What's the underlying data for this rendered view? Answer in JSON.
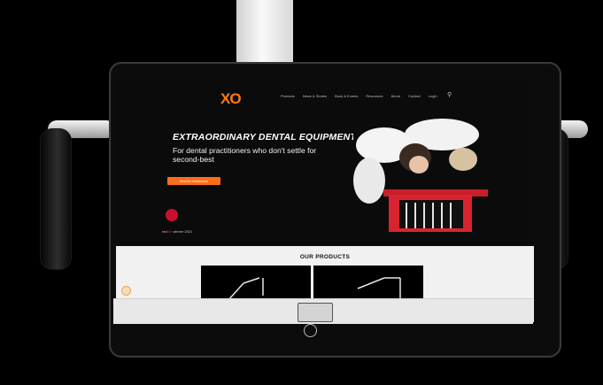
{
  "navigation": {
    "logo": "XO",
    "items": [
      "Products",
      "News & Stories",
      "Book & Events",
      "Resources",
      "About",
      "Contact",
      "Login"
    ]
  },
  "hero": {
    "headline": "EXTRAORDINARY DENTAL EQUIPMENT",
    "subtitle": "For dental practitioners who don't settle for second-best",
    "cta_label": "Read the reviews here",
    "award_prefix": "red",
    "award_highlight": "dot",
    "award_suffix": " winner 2021"
  },
  "products": {
    "title": "OUR PRODUCTS"
  },
  "icons": {
    "search": "search-icon",
    "keyboard": "keyboard-icon",
    "home": "home-button-icon",
    "award": "red-dot-award-icon",
    "chat": "chat-icon"
  },
  "colors": {
    "accent": "#ff6c1a",
    "award_red": "#c8102e",
    "screen_bg": "#0b0b0b",
    "products_bg": "#f1f1f1"
  }
}
